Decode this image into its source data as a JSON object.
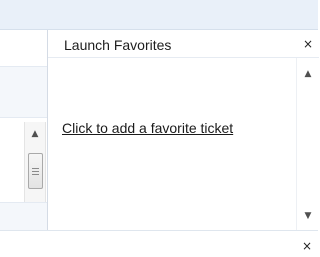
{
  "panel": {
    "title": "Launch Favorites",
    "empty_link": "Click to add a favorite ticket",
    "close_glyph": "×"
  },
  "bottom_bar": {
    "close_glyph": "×"
  },
  "icons": {
    "scroll_up": "▲",
    "scroll_down": "▼"
  },
  "colors": {
    "top_band": "#e9f0f9",
    "panel_border": "#d4dbe5"
  }
}
